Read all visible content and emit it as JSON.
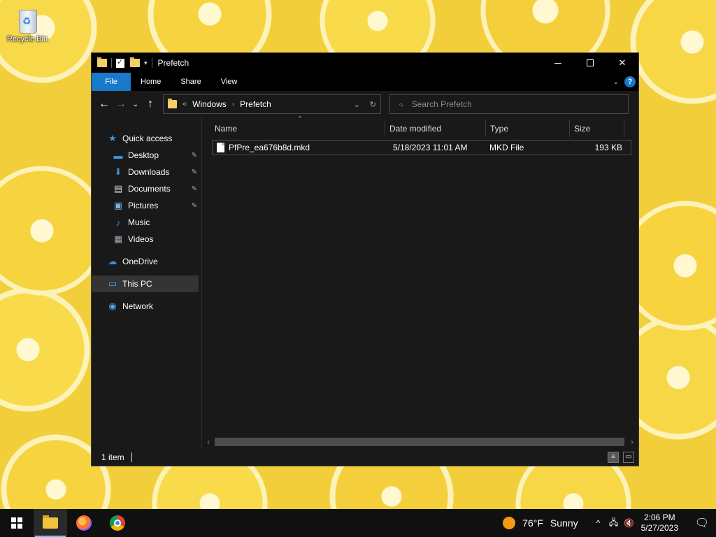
{
  "desktop": {
    "recycle_bin_label": "Recycle Bin"
  },
  "window": {
    "title": "Prefetch",
    "quick_access_toolbar": [
      "folder",
      "properties",
      "new-folder"
    ],
    "controls": {
      "minimize": "—",
      "maximize": "□",
      "close": "✕"
    }
  },
  "ribbon": {
    "tabs": [
      {
        "label": "File"
      },
      {
        "label": "Home"
      },
      {
        "label": "Share"
      },
      {
        "label": "View"
      }
    ],
    "help": "?"
  },
  "nav": {
    "back": "←",
    "forward": "→",
    "recent": "⌄",
    "up": "↑",
    "overflow": "«",
    "breadcrumbs": [
      "Windows",
      "Prefetch"
    ],
    "refresh": "↻",
    "dropdown": "⌄"
  },
  "search": {
    "placeholder": "Search Prefetch"
  },
  "sidebar": {
    "items": [
      {
        "label": "Quick access",
        "icon": "star-icon",
        "glyph": "★",
        "color": "#3a96dd"
      },
      {
        "label": "Desktop",
        "icon": "desktop-icon",
        "glyph": "▬",
        "color": "#3a96dd",
        "pinned": true
      },
      {
        "label": "Downloads",
        "icon": "download-icon",
        "glyph": "⬇",
        "color": "#3a96dd",
        "pinned": true
      },
      {
        "label": "Documents",
        "icon": "document-icon",
        "glyph": "▤",
        "color": "#cfd7df",
        "pinned": true
      },
      {
        "label": "Pictures",
        "icon": "picture-icon",
        "glyph": "▣",
        "color": "#7ab0e0",
        "pinned": true
      },
      {
        "label": "Music",
        "icon": "music-icon",
        "glyph": "♪",
        "color": "#3a96dd"
      },
      {
        "label": "Videos",
        "icon": "video-icon",
        "glyph": "▦",
        "color": "#9aa7b5"
      },
      {
        "label": "OneDrive",
        "icon": "cloud-icon",
        "glyph": "☁",
        "color": "#2f8fe0"
      },
      {
        "label": "This PC",
        "icon": "computer-icon",
        "glyph": "▭",
        "color": "#4fa3e8"
      },
      {
        "label": "Network",
        "icon": "network-icon",
        "glyph": "◉",
        "color": "#4fa3e8"
      }
    ],
    "pin_glyph": "📌"
  },
  "columns": {
    "name": "Name",
    "date": "Date modified",
    "type": "Type",
    "size": "Size",
    "sort_glyph": "^"
  },
  "files": [
    {
      "name": "PfPre_ea676b8d.mkd",
      "date": "5/18/2023 11:01 AM",
      "type": "MKD File",
      "size": "193 KB"
    }
  ],
  "status": {
    "item_count": "1 item"
  },
  "taskbar": {
    "weather_temp": "76°F",
    "weather_text": "Sunny",
    "tray_chevron": "^",
    "time": "2:06 PM",
    "date": "5/27/2023"
  },
  "colors": {
    "accent": "#1979ca",
    "window_bg": "#191919",
    "taskbar_bg": "#101010"
  }
}
